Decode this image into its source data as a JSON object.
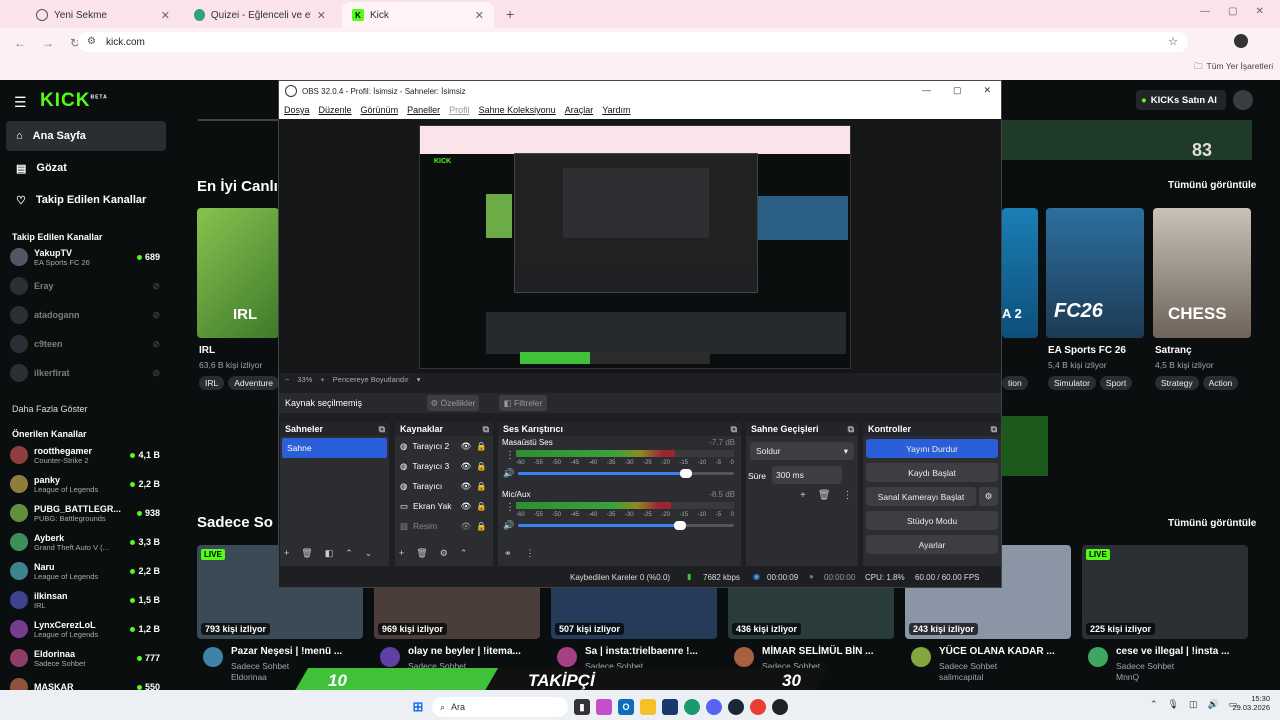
{
  "browser": {
    "tabs": [
      {
        "label": "Yeni Sekme"
      },
      {
        "label": "Quizei - Eğlenceli ve etkileşimli"
      },
      {
        "label": "Kick"
      }
    ],
    "url": "kick.com",
    "bookmarks_label": "Tüm Yer İşaretleri"
  },
  "kick": {
    "logo": "KICK",
    "logo_tag": "BETA",
    "buy_button": "KICKs Satın Al",
    "nav": [
      {
        "label": "Ana Sayfa",
        "icon": "home-icon"
      },
      {
        "label": "Gözat",
        "icon": "browse-icon"
      },
      {
        "label": "Takip Edilen Kanallar",
        "icon": "heart-icon"
      }
    ],
    "followed_heading": "Takip Edilen Kanallar",
    "followed": [
      {
        "name": "YakupTV",
        "game": "EA Sports FC 26",
        "viewers": "689",
        "live": true
      },
      {
        "name": "Eray",
        "game": "",
        "viewers": "",
        "live": false
      },
      {
        "name": "atadogann",
        "game": "",
        "viewers": "",
        "live": false
      },
      {
        "name": "c9teen",
        "game": "",
        "viewers": "",
        "live": false
      },
      {
        "name": "ilkerfirat",
        "game": "",
        "viewers": "",
        "live": false
      }
    ],
    "show_more": "Daha Fazla Göster",
    "recommended_heading": "Önerilen Kanallar",
    "recommended": [
      {
        "name": "rootthegamer",
        "game": "Counter-Strike 2",
        "viewers": "4,1 B"
      },
      {
        "name": "panky",
        "game": "League of Legends",
        "viewers": "2,2 B"
      },
      {
        "name": "PUBG_BATTLEGR...",
        "game": "PUBG: Battlegrounds",
        "viewers": "938"
      },
      {
        "name": "Ayberk",
        "game": "Grand Theft Auto V (...",
        "viewers": "3,3 B"
      },
      {
        "name": "Naru",
        "game": "League of Legends",
        "viewers": "2,2 B"
      },
      {
        "name": "ilkinsan",
        "game": "IRL",
        "viewers": "1,5 B"
      },
      {
        "name": "LynxCerezLoL",
        "game": "League of Legends",
        "viewers": "1,2 B"
      },
      {
        "name": "Eldorinaa",
        "game": "Sadece Sohbet",
        "viewers": "777"
      },
      {
        "name": "MASKAR",
        "game": "",
        "viewers": "550"
      }
    ],
    "categories_heading": "En İyi Canlı",
    "see_all": "Tümünü görüntüle",
    "categories": [
      {
        "name": "IRL",
        "viewers": "63,6 B kişi izliyor",
        "tags": [
          "IRL",
          "Adventure"
        ],
        "art": "IRL"
      },
      {
        "name": "EA Sports FC 26",
        "viewers": "5,4 B kişi izliyor",
        "tags": [
          "Simulator",
          "Sport"
        ],
        "art": "FC26"
      },
      {
        "name": "Satranç",
        "viewers": "4,5 B kişi izliyor",
        "tags": [
          "Strategy",
          "Action"
        ],
        "art": "CHESS"
      }
    ],
    "partial_tag": "tion",
    "partial_card_art": "A 2",
    "chat_heading": "Sadece So",
    "chat_see_all": "Tümünü görüntüle",
    "videos": [
      {
        "viewers": "793 kişi izliyor",
        "title": "Pazar Neşesi | !menü ...",
        "cat": "Sadece Sohbet",
        "chan": "Eldorinaa",
        "live": true
      },
      {
        "viewers": "969 kişi izliyor",
        "title": "olay ne beyler | !itema...",
        "cat": "Sadece Sohbet",
        "chan": "",
        "live": false
      },
      {
        "viewers": "507 kişi izliyor",
        "title": "Sa | insta:trielbaenre !...",
        "cat": "Sadece Sohbet",
        "chan": "",
        "live": false
      },
      {
        "viewers": "436 kişi izliyor",
        "title": "MİMAR SELİMÜL BİN ...",
        "cat": "Sadece Sohbet",
        "chan": "Zeyn",
        "live": false
      },
      {
        "viewers": "243 kişi izliyor",
        "title": "YÜCE OLANA KADAR ...",
        "cat": "Sadece Sohbet",
        "chan": "salimcapital",
        "live": false
      },
      {
        "viewers": "225 kişi izliyor",
        "title": "cese ve illegal | !insta ...",
        "cat": "Sadece Sohbet",
        "chan": "MnnQ",
        "live": true
      }
    ],
    "live_badge": "LIVE",
    "hero_counter": "83"
  },
  "overlay": {
    "left_num": "10",
    "label": "TAKİPÇİ",
    "right_num": "30"
  },
  "obs": {
    "title": "OBS 32.0.4 - Profil: İsimsiz - Sahneler: İsimsiz",
    "menu": [
      "Dosya",
      "Düzenle",
      "Görünüm",
      "Paneller",
      "Profil",
      "Sahne Koleksiyonu",
      "Araçlar",
      "Yardım"
    ],
    "zoom": "33%",
    "fit_label": "Pencereye Boyutlandır",
    "no_source": "Kaynak seçilmemiş",
    "properties_btn": "Özellikler",
    "filters_btn": "Filtreler",
    "scenes_header": "Sahneler",
    "scenes": [
      "Sahne"
    ],
    "sources_header": "Kaynaklar",
    "sources": [
      {
        "label": "Tarayıcı 2",
        "icon": "browser-icon"
      },
      {
        "label": "Tarayıcı 3",
        "icon": "browser-icon"
      },
      {
        "label": "Tarayıcı",
        "icon": "browser-icon"
      },
      {
        "label": "Ekran Yak",
        "icon": "monitor-icon"
      },
      {
        "label": "Resim",
        "icon": "image-icon"
      }
    ],
    "mixer_header": "Ses Karıştırıcı",
    "mixer": [
      {
        "name": "Masaüstü Ses",
        "db": "-7.7 dB",
        "level": 0.73,
        "volume": 0.78
      },
      {
        "name": "Mic/Aux",
        "db": "-8.5 dB",
        "level": 0.71,
        "volume": 0.75
      }
    ],
    "meter_scale": [
      "-60",
      "-55",
      "-50",
      "-45",
      "-40",
      "-35",
      "-30",
      "-25",
      "-20",
      "-15",
      "-10",
      "-5",
      "0"
    ],
    "transitions_header": "Sahne Geçişleri",
    "transition": "Soldur",
    "duration_label": "Süre",
    "duration": "300 ms",
    "controls_header": "Kontroller",
    "controls": [
      "Yayını Durdur",
      "Kaydı Başlat",
      "Sanal Kamerayı Başlat",
      "Stüdyo Modu",
      "Ayarlar"
    ],
    "status": {
      "dropped": "Kaybedilen Kareler 0 (%0.0)",
      "bitrate": "7682 kbps",
      "stream_time": "00:00:09",
      "rec_time": "00:00:00",
      "cpu": "CPU: 1.8%",
      "fps": "60.00 / 60.00 FPS"
    }
  },
  "taskbar": {
    "search": "Ara",
    "time": "15:30",
    "date": "29.03.2026"
  },
  "colors": {
    "kick_green": "#53fc18",
    "obs_blue": "#2b5fd9"
  }
}
